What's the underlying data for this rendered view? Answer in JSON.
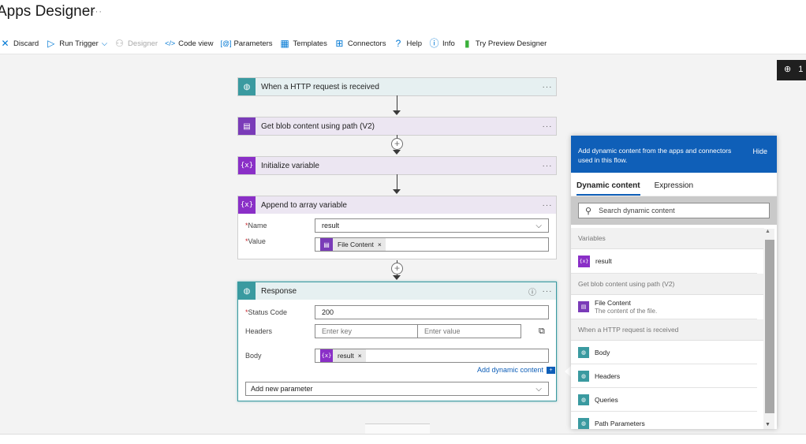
{
  "app": {
    "title": "Apps Designer",
    "title_more": "···"
  },
  "toolbar": {
    "discard": "Discard",
    "run_trigger": "Run Trigger",
    "designer": "Designer",
    "code_view": "Code view",
    "parameters": "Parameters",
    "templates": "Templates",
    "connectors": "Connectors",
    "help": "Help",
    "info": "Info",
    "try_preview": "Try Preview Designer"
  },
  "zoom": {
    "label": "1"
  },
  "flow": {
    "trigger": {
      "title": "When a HTTP request is received",
      "more": "···"
    },
    "get_blob": {
      "title": "Get blob content using path (V2)",
      "more": "···"
    },
    "init_var": {
      "title": "Initialize variable",
      "more": "···",
      "icon_text": "{x}"
    },
    "append": {
      "title": "Append to array variable",
      "more": "···",
      "icon_text": "{x}",
      "name_label": "Name",
      "name_value": "result",
      "value_label": "Value",
      "value_token": "File Content",
      "token_close": "×"
    },
    "response": {
      "title": "Response",
      "more": "···",
      "info": "ⓘ",
      "status_label": "Status Code",
      "status_value": "200",
      "headers_label": "Headers",
      "headers_key_placeholder": "Enter key",
      "headers_value_placeholder": "Enter value",
      "body_label": "Body",
      "body_token": "result",
      "body_token_icon": "{x}",
      "token_close": "×",
      "add_dynamic": "Add dynamic content",
      "add_param": "Add new parameter"
    }
  },
  "panel": {
    "header": "Add dynamic content from the apps and connectors used in this flow.",
    "hide": "Hide",
    "tab_dynamic": "Dynamic content",
    "tab_expression": "Expression",
    "search_placeholder": "Search dynamic content",
    "sections": [
      {
        "title": "Variables"
      },
      {
        "title": "Get blob content using path (V2)"
      },
      {
        "title": "When a HTTP request is received"
      }
    ],
    "var_result": {
      "label": "result",
      "icon_text": "{x}"
    },
    "file_content": {
      "label": "File Content",
      "sub": "The content of the file."
    },
    "http_items": [
      "Body",
      "Headers",
      "Queries",
      "Path Parameters"
    ]
  },
  "colors": {
    "accent": "#0f5fb8",
    "teal": "#3a9aa0",
    "purple": "#7a3bb8"
  }
}
